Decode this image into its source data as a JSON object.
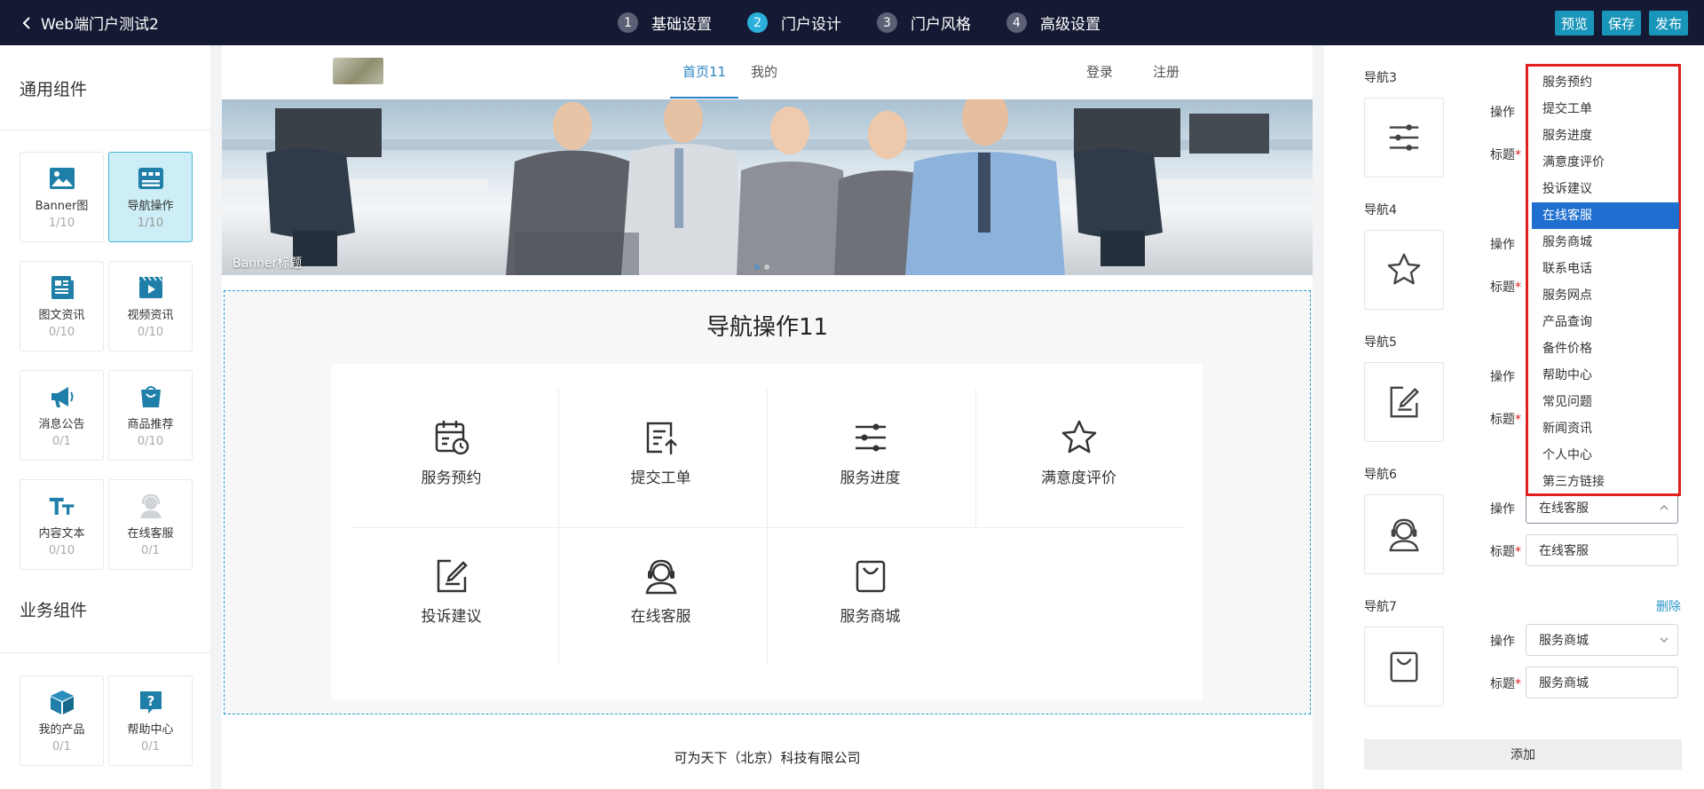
{
  "topbar": {
    "title": "Web端门户测试2",
    "steps": [
      {
        "num": "1",
        "label": "基础设置"
      },
      {
        "num": "2",
        "label": "门户设计"
      },
      {
        "num": "3",
        "label": "门户风格"
      },
      {
        "num": "4",
        "label": "高级设置"
      }
    ],
    "active_step": 2,
    "buttons": {
      "preview": "预览",
      "save": "保存",
      "publish": "发布"
    }
  },
  "left": {
    "general_title": "通用组件",
    "business_title": "业务组件",
    "general_components": [
      {
        "name": "Banner图",
        "count": "1/10",
        "icon": "image-icon"
      },
      {
        "name": "导航操作",
        "count": "1/10",
        "icon": "nav-icon"
      },
      {
        "name": "图文资讯",
        "count": "0/10",
        "icon": "article-icon"
      },
      {
        "name": "视频资讯",
        "count": "0/10",
        "icon": "video-icon"
      },
      {
        "name": "消息公告",
        "count": "0/1",
        "icon": "megaphone-icon"
      },
      {
        "name": "商品推荐",
        "count": "0/10",
        "icon": "shopping-bag-icon"
      },
      {
        "name": "内容文本",
        "count": "0/10",
        "icon": "text-icon"
      },
      {
        "name": "在线客服",
        "count": "0/1",
        "icon": "customer-service-icon"
      }
    ],
    "business_components": [
      {
        "name": "我的产品",
        "count": "0/1",
        "icon": "cube-icon"
      },
      {
        "name": "帮助中心",
        "count": "0/1",
        "icon": "help-icon"
      }
    ]
  },
  "canvas": {
    "nav": {
      "home": "首页11",
      "mine": "我的",
      "login": "登录",
      "register": "注册"
    },
    "banner_title": "Banner标题",
    "nav_section_title": "导航操作11",
    "nav_items": [
      {
        "label": "服务预约",
        "icon": "calendar-clock-icon"
      },
      {
        "label": "提交工单",
        "icon": "submit-ticket-icon"
      },
      {
        "label": "服务进度",
        "icon": "sliders-icon"
      },
      {
        "label": "满意度评价",
        "icon": "star-icon"
      },
      {
        "label": "投诉建议",
        "icon": "edit-note-icon"
      },
      {
        "label": "在线客服",
        "icon": "customer-service-icon"
      },
      {
        "label": "服务商城",
        "icon": "shopping-bag-icon"
      }
    ],
    "footer": "可为天下（北京）科技有限公司"
  },
  "right": {
    "op_label": "操作",
    "title_label": "标题",
    "navs": [
      {
        "label": "导航3",
        "icon": "sliders-icon",
        "operation": "",
        "title": ""
      },
      {
        "label": "导航4",
        "icon": "star-icon",
        "operation": "",
        "title": ""
      },
      {
        "label": "导航5",
        "icon": "edit-note-icon",
        "operation": "",
        "title": ""
      },
      {
        "label": "导航6",
        "icon": "customer-service-icon",
        "operation": "在线客服",
        "title": "在线客服"
      },
      {
        "label": "导航7",
        "icon": "shopping-bag-icon",
        "operation": "服务商城",
        "title": "服务商城",
        "delete": "删除"
      }
    ],
    "add_button": "添加"
  },
  "dropdown": {
    "options": [
      "服务预约",
      "提交工单",
      "服务进度",
      "满意度评价",
      "投诉建议",
      "在线客服",
      "服务商城",
      "联系电话",
      "服务网点",
      "产品查询",
      "备件价格",
      "帮助中心",
      "常见问题",
      "新闻资讯",
      "个人中心",
      "第三方链接"
    ],
    "selected": "在线客服"
  },
  "colors": {
    "topbar": "#141a33",
    "accent": "#1995b9",
    "step_active": "#2bb0dc",
    "highlight_border": "#e02020",
    "selected_option": "#1f6fd0"
  }
}
